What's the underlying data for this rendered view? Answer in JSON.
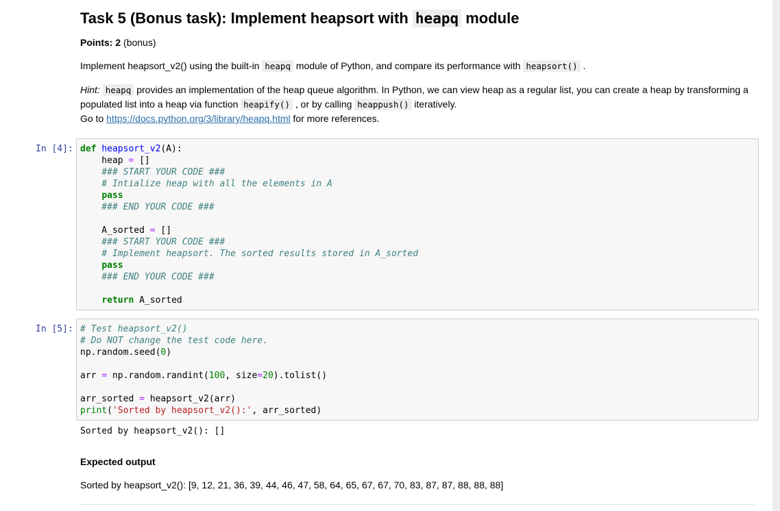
{
  "task": {
    "title_prefix": "Task 5 (Bonus task): Implement heapsort with ",
    "title_code": "heapq",
    "title_suffix": " module",
    "points_label": "Points:",
    "points_value": " 2",
    "points_note": " (bonus)",
    "desc_1": "Implement heapsort_v2() using the built-in ",
    "desc_code_1": "heapq",
    "desc_2": " module of Python, and compare its performance with ",
    "desc_code_2": "heapsort()",
    "desc_3": " .",
    "hint_label": "Hint:",
    "hint_code_1": "heapq",
    "hint_1": " provides an implementation of the heap queue algorithm. In Python, we can view heap as a regular list, you can create a heap by transforming a",
    "hint_2": "populated list into a heap via function ",
    "hint_code_2": "heapify()",
    "hint_3": " , or by calling ",
    "hint_code_3": "heappush()",
    "hint_4": " iteratively.",
    "goto_1": "Go to ",
    "goto_link": "https://docs.python.org/3/library/heapq.html",
    "goto_2": " for more references."
  },
  "cell1": {
    "prompt": "In [4]:",
    "lines": {
      "l1_kw": "def",
      "l1_fn": "heapsort_v2",
      "l1_rest": "(A):",
      "l2_a": "    heap ",
      "l2_op": "=",
      "l2_b": " []",
      "l3": "    ### START YOUR CODE ###",
      "l4": "    # Intialize heap with all the elements in A",
      "l5": "pass",
      "l6": "    ### END YOUR CODE ###",
      "l8_a": "    A_sorted ",
      "l8_op": "=",
      "l8_b": " []",
      "l9": "    ### START YOUR CODE ###",
      "l10": "    # Implement heapsort. The sorted results stored in A_sorted",
      "l11": "pass",
      "l12": "    ### END YOUR CODE ###",
      "l14_kw": "return",
      "l14_rest": " A_sorted"
    }
  },
  "cell2": {
    "prompt": "In [5]:",
    "lines": {
      "l1": "# Test heapsort_v2()",
      "l2": "# Do NOT change the test code here.",
      "l3_a": "np",
      "l3_b": ".random.seed(",
      "l3_num": "0",
      "l3_c": ")",
      "l5_a": "arr ",
      "l5_op": "=",
      "l5_b": " np.random.randint(",
      "l5_num1": "100",
      "l5_c": ", size",
      "l5_op2": "=",
      "l5_num2": "20",
      "l5_d": ").tolist()",
      "l7_a": "arr_sorted ",
      "l7_op": "=",
      "l7_b": " heapsort_v2(arr)",
      "l8_fn": "print",
      "l8_a": "(",
      "l8_str": "'Sorted by heapsort_v2():'",
      "l8_b": ", arr_sorted)"
    },
    "output": "Sorted by heapsort_v2(): []"
  },
  "expected": {
    "heading": "Expected output",
    "text": "Sorted by heapsort_v2(): [9, 12, 21, 36, 39, 44, 46, 47, 58, 64, 65, 67, 67, 70, 83, 87, 87, 88, 88, 88]"
  }
}
